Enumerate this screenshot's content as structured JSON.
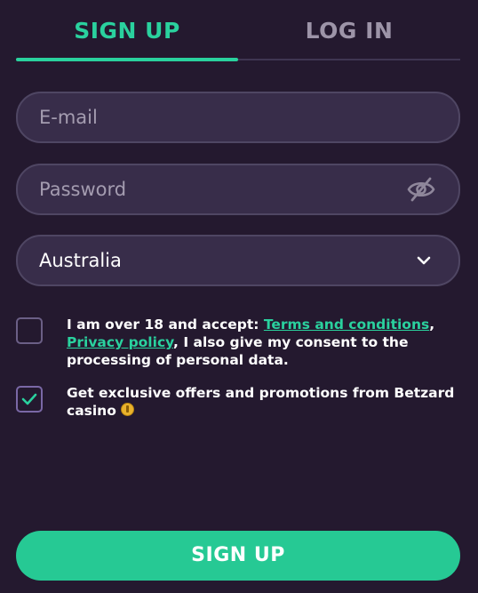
{
  "tabs": {
    "signup_label": "SIGN UP",
    "login_label": "LOG IN",
    "active": "signup"
  },
  "form": {
    "email_placeholder": "E-mail",
    "password_placeholder": "Password",
    "country_value": "Australia",
    "terms": {
      "checked": false,
      "text_before": "I am over 18 and accept: ",
      "terms_link": "Terms and conditions",
      "separator": ",",
      "privacy_link": "Privacy policy",
      "text_after": ", I also give my consent to the processing of personal data."
    },
    "offers": {
      "checked": true,
      "text": "Get exclusive offers and promotions from Betzard casino "
    },
    "submit_label": "SIGN UP"
  },
  "colors": {
    "background": "#24192f",
    "accent": "#2ad19e",
    "button": "#26c994",
    "field_bg": "#382d4a",
    "field_border": "#4f4663",
    "inactive_tab": "#9d94a8"
  },
  "icons": {
    "password_toggle": "eye-slash-icon",
    "country_dropdown": "chevron-down-icon",
    "offers_emoji": "money-bag-icon"
  }
}
